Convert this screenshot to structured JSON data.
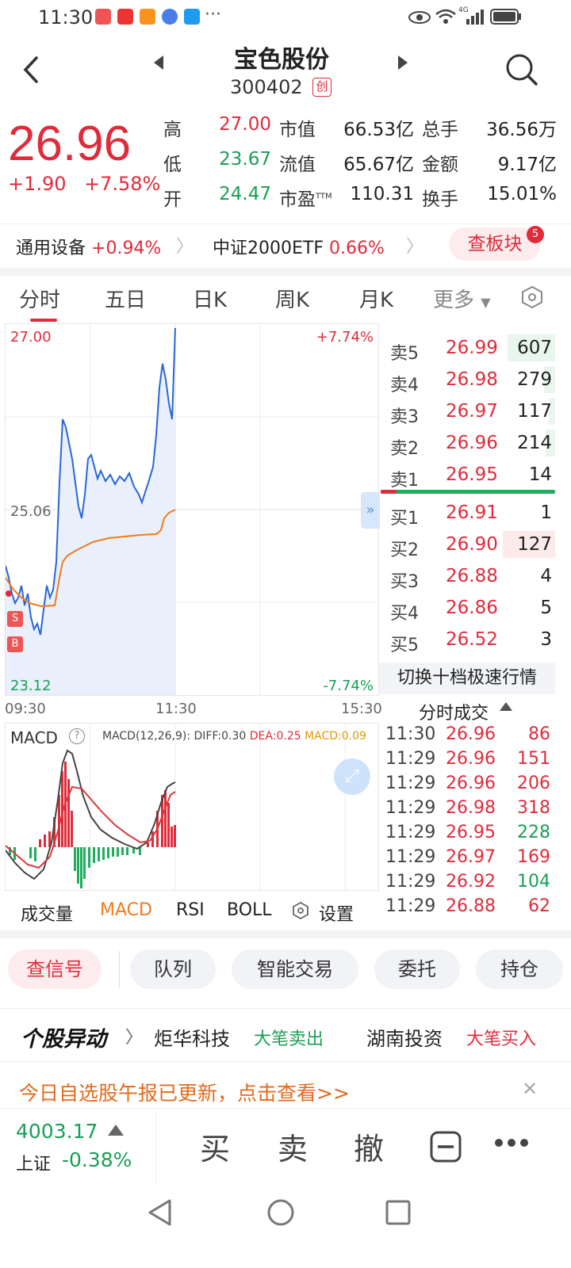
{
  "status": {
    "time": "11:30",
    "network": "4G"
  },
  "header": {
    "stock_name": "宝色股份",
    "stock_code": "300402",
    "board_badge": "创"
  },
  "quote": {
    "price": "26.96",
    "change": "+1.90",
    "change_pct": "+7.58%",
    "rows": [
      [
        {
          "label": "高",
          "value": "27.00",
          "color": "red"
        },
        {
          "label": "市值",
          "value": "66.53亿"
        },
        {
          "label": "总手",
          "value": "36.56万"
        }
      ],
      [
        {
          "label": "低",
          "value": "23.67",
          "color": "green"
        },
        {
          "label": "流值",
          "value": "65.67亿"
        },
        {
          "label": "金额",
          "value": "9.17亿"
        }
      ],
      [
        {
          "label": "开",
          "value": "24.47",
          "color": "green"
        },
        {
          "label": "市盈",
          "sup": "TTM",
          "value": "110.31"
        },
        {
          "label": "换手",
          "value": "15.01%"
        }
      ]
    ]
  },
  "sector": {
    "industry": "通用设备",
    "industry_pct": "+0.94%",
    "etf": "中证2000ETF",
    "etf_pct": "0.66%",
    "board_button": "查板块",
    "board_badge": "5"
  },
  "tabs": {
    "items": [
      "分时",
      "五日",
      "日K",
      "周K",
      "月K"
    ],
    "more": "更多",
    "active": 0
  },
  "chart": {
    "y_high": "27.00",
    "y_mid": "25.06",
    "y_low": "23.12",
    "pct_high": "+7.74%",
    "pct_low": "-7.74%",
    "x_start": "09:30",
    "x_mid": "11:30",
    "x_end": "15:30",
    "marker_s": "S",
    "marker_b": "B"
  },
  "orderbook": {
    "sell": [
      {
        "label": "卖5",
        "price": "26.99",
        "vol": "607"
      },
      {
        "label": "卖4",
        "price": "26.98",
        "vol": "279"
      },
      {
        "label": "卖3",
        "price": "26.97",
        "vol": "117"
      },
      {
        "label": "卖2",
        "price": "26.96",
        "vol": "214"
      },
      {
        "label": "卖1",
        "price": "26.95",
        "vol": "14"
      }
    ],
    "buy": [
      {
        "label": "买1",
        "price": "26.91",
        "vol": "1"
      },
      {
        "label": "买2",
        "price": "26.90",
        "vol": "127"
      },
      {
        "label": "买3",
        "price": "26.88",
        "vol": "4"
      },
      {
        "label": "买4",
        "price": "26.86",
        "vol": "5"
      },
      {
        "label": "买5",
        "price": "26.52",
        "vol": "3"
      }
    ],
    "switch_label": "切换十档极速行情"
  },
  "trades": {
    "title": "分时成交",
    "rows": [
      {
        "time": "11:30",
        "price": "26.96",
        "vol": "86",
        "color": "red"
      },
      {
        "time": "11:29",
        "price": "26.96",
        "vol": "151",
        "color": "red"
      },
      {
        "time": "11:29",
        "price": "26.96",
        "vol": "206",
        "color": "red"
      },
      {
        "time": "11:29",
        "price": "26.98",
        "vol": "318",
        "color": "red"
      },
      {
        "time": "11:29",
        "price": "26.95",
        "vol": "228",
        "color": "green"
      },
      {
        "time": "11:29",
        "price": "26.97",
        "vol": "169",
        "color": "red"
      },
      {
        "time": "11:29",
        "price": "26.92",
        "vol": "104",
        "color": "green"
      },
      {
        "time": "11:29",
        "price": "26.88",
        "vol": "62",
        "color": "red"
      }
    ]
  },
  "macd": {
    "title": "MACD",
    "params": "MACD(12,26,9):",
    "diff": "DIFF:0.30",
    "dea": "DEA:0.25",
    "macd": "MACD:0.09"
  },
  "indicator_tabs": {
    "items": [
      "成交量",
      "MACD",
      "RSI",
      "BOLL"
    ],
    "settings": "设置",
    "active": 1
  },
  "actions": [
    "查信号",
    "队列",
    "智能交易",
    "委托",
    "持仓"
  ],
  "abnormal": {
    "title": "个股异动",
    "items": [
      {
        "name": "炬华科技",
        "action": "大笔卖出",
        "color": "green"
      },
      {
        "name": "湖南投资",
        "action": "大笔买入",
        "color": "red"
      }
    ]
  },
  "notice": {
    "text": "今日自选股午报已更新，点击查看>>"
  },
  "bottom": {
    "index_value": "4003.17",
    "index_name": "上证",
    "index_pct": "-0.38%",
    "buy": "买",
    "sell": "卖",
    "cancel": "撤"
  },
  "colors": {
    "up": "#e02b3b",
    "down": "#1a9e55",
    "accent": "#e02b3b",
    "price_line": "#2a66d9",
    "avg_line": "#f07a1e"
  }
}
